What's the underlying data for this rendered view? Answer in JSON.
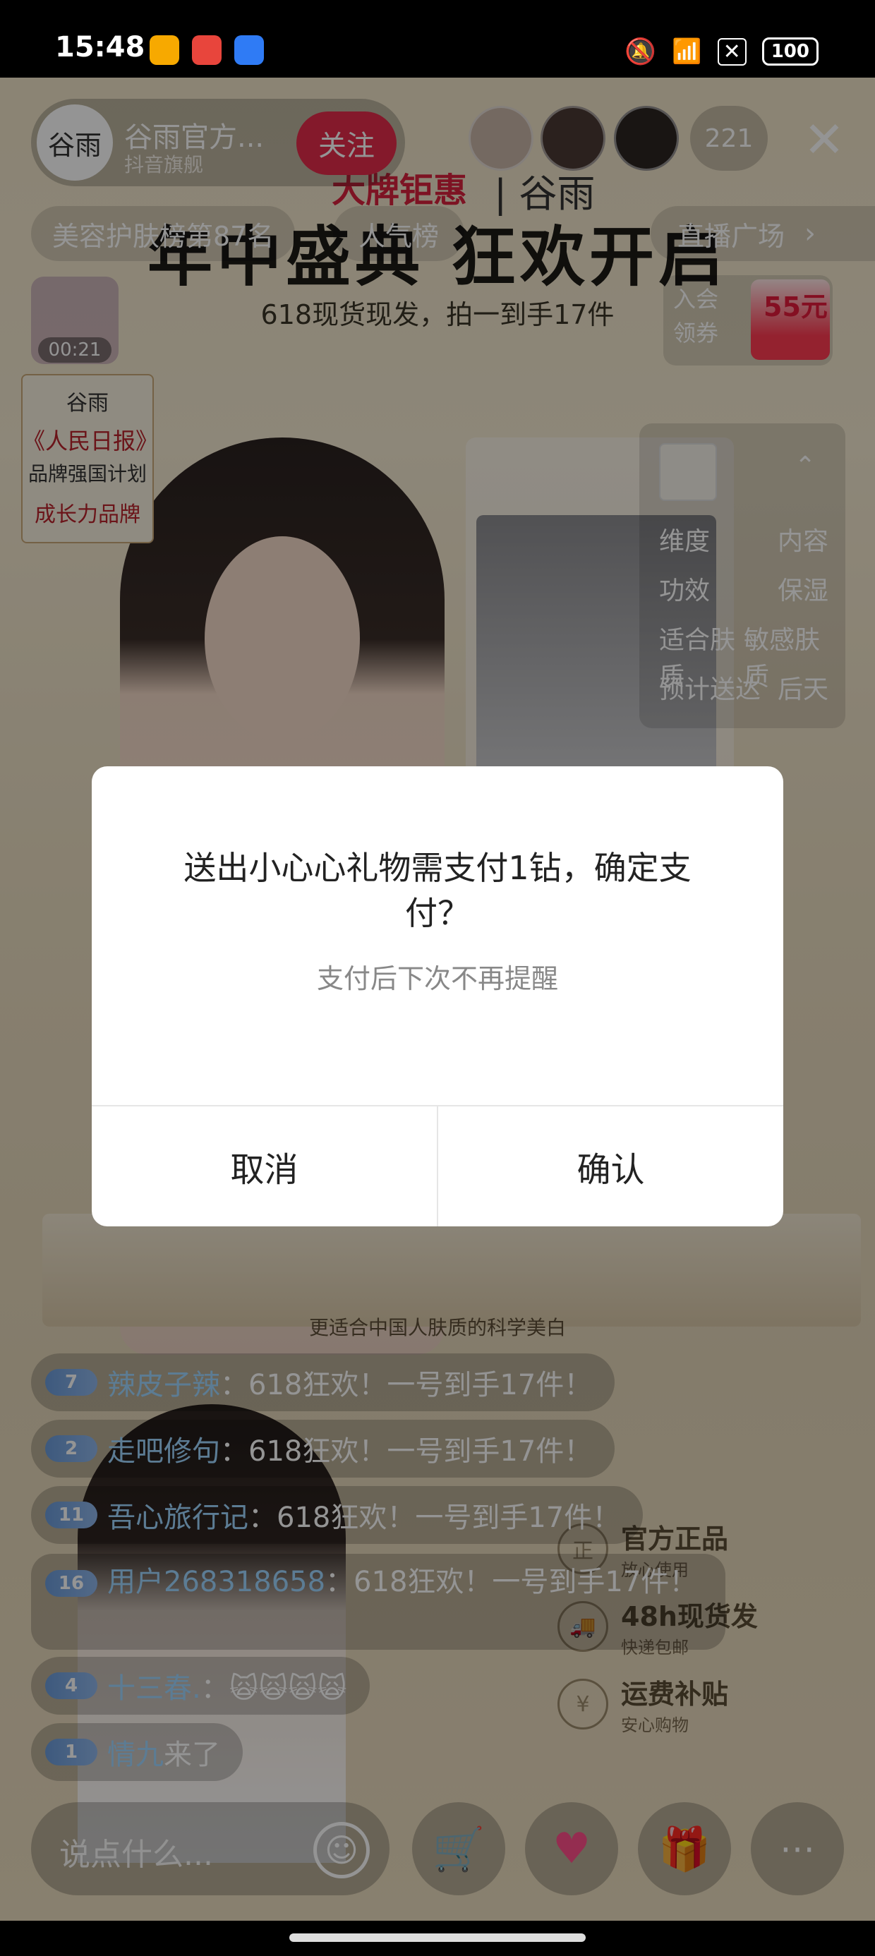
{
  "status_bar": {
    "time": "15:48",
    "battery": "100"
  },
  "live": {
    "host_name": "谷雨官方...",
    "host_subtitle": "抖音旗舰",
    "host_avatar_text": "谷雨",
    "follow_label": "关注",
    "viewer_count": "221",
    "rank_label": "美容护肤榜第87名",
    "popularity_label": "人气榜",
    "plaza_label": "直播广场",
    "gift_timer": "00:21",
    "coupon_text_1": "入会",
    "coupon_text_2": "领券",
    "coupon_amount": "55元",
    "banner_brand": "大牌钜惠",
    "banner_brand2": "| 谷雨",
    "banner_title": "年中盛典 狂欢开启",
    "banner_subtitle": "618现货现发，拍一到手17件",
    "badge": {
      "l1": "谷雨",
      "l2": "《人民日报》",
      "l3": "品牌强国计划",
      "l4": "成长力品牌"
    },
    "product_info": [
      {
        "k": "维度",
        "v": "内容"
      },
      {
        "k": "功效",
        "v": "保湿"
      },
      {
        "k": "适合肤质",
        "v": "敏感肤质"
      },
      {
        "k": "预计送达",
        "v": "后天"
      }
    ],
    "bottom_caption": "更适合中国人肤质的科学美白",
    "guarantees": [
      {
        "title": "官方正品",
        "sub": "放心使用",
        "icon": "正"
      },
      {
        "title": "48h现货发",
        "sub": "快递包邮",
        "icon": "🚚"
      },
      {
        "title": "运费补贴",
        "sub": "安心购物",
        "icon": "¥"
      }
    ]
  },
  "comments": [
    {
      "level": "7",
      "user": "辣皮子辣",
      "text": "：618狂欢！一号到手17件！"
    },
    {
      "level": "2",
      "user": "走吧修句",
      "text": "：618狂欢！一号到手17件！"
    },
    {
      "level": "11",
      "user": "吾心旅行记",
      "text": "：618狂欢！一号到手17件！"
    },
    {
      "level": "16",
      "user": "用户268318658",
      "text": "：618狂欢！一号到手17件！"
    },
    {
      "level": "4",
      "user": "十三春.",
      "text": "：🙀🙀🙀🙀"
    },
    {
      "level": "1",
      "user": "情九",
      "text": " 来了"
    }
  ],
  "input_placeholder": "说点什么...",
  "dialog": {
    "title": "送出小心心礼物需支付1钻，确定支付？",
    "subtitle": "支付后下次不再提醒",
    "cancel_label": "取消",
    "confirm_label": "确认"
  }
}
